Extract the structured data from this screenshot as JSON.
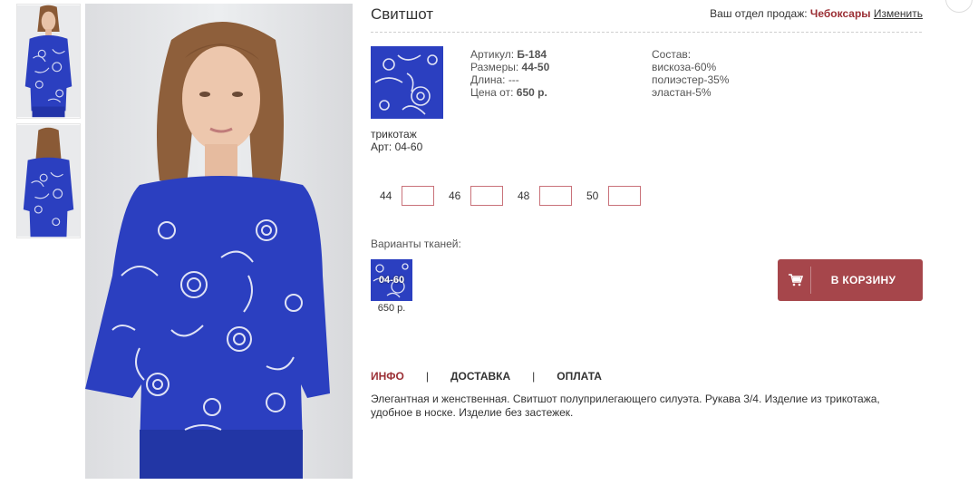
{
  "product": {
    "title": "Свитшот",
    "sales_dept_prefix": "Ваш отдел продаж:",
    "city": "Чебоксары",
    "change_label": "Изменить",
    "fabric_type": "трикотаж",
    "fabric_art": "Арт: 04-60",
    "article_label": "Артикул:",
    "article_value": "Б-184",
    "sizes_label": "Размеры:",
    "sizes_value": "44-50",
    "length_label": "Длина:",
    "length_value": "---",
    "price_label": "Цена от:",
    "price_value": "650 р.",
    "composition_label": "Состав:",
    "composition": [
      "вискоза-60%",
      "полиэстер-35%",
      "эластан-5%"
    ]
  },
  "sizes": [
    {
      "label": "44",
      "value": ""
    },
    {
      "label": "46",
      "value": ""
    },
    {
      "label": "48",
      "value": ""
    },
    {
      "label": "50",
      "value": ""
    }
  ],
  "variants": {
    "label": "Варианты тканей:",
    "items": [
      {
        "code": "04-60",
        "price": "650 р."
      }
    ]
  },
  "cart": {
    "label": "В КОРЗИНУ"
  },
  "tabs": [
    {
      "label": "ИНФО",
      "active": true
    },
    {
      "label": "ДОСТАВКА",
      "active": false
    },
    {
      "label": "ОПЛАТА",
      "active": false
    }
  ],
  "description": "Элегантная и женственная. Свитшот полуприлегающего силуэта. Рукава 3/4. Изделие из трикотажа, удобное в носке. Изделие без застежек.",
  "colors": {
    "accent": "#a6464b",
    "city": "#9b2f35",
    "fabric_blue": "#2b3fc0",
    "input_border": "#c9727a"
  },
  "icons": {
    "cart": "cart-icon"
  }
}
